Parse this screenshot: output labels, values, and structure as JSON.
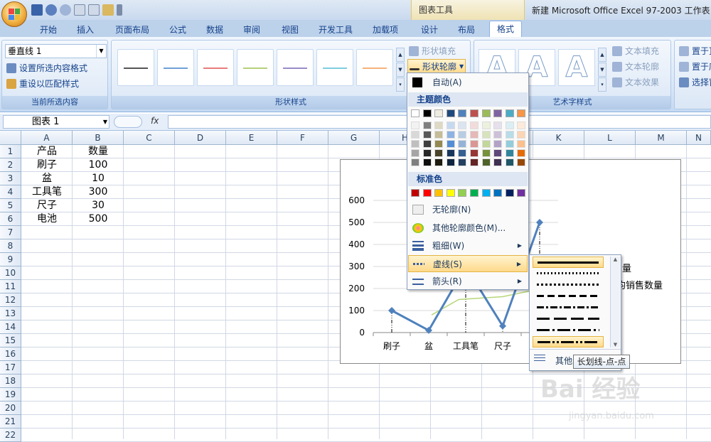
{
  "app": {
    "window_title": "新建 Microsoft Office Excel 97-2003 工作表",
    "context_group": "图表工具"
  },
  "tabs": [
    "开始",
    "插入",
    "页面布局",
    "公式",
    "数据",
    "审阅",
    "视图",
    "开发工具",
    "加载项",
    "设计",
    "布局",
    "格式"
  ],
  "active_tab": "格式",
  "ribbon": {
    "current_selection": {
      "combo_value": "垂直线 1",
      "format_selection": "设置所选内容格式",
      "reset_style": "重设以匹配样式",
      "group_label": "当前所选内容"
    },
    "shape_styles": {
      "group_label": "形状样式",
      "fill": "形状填充",
      "outline": "形状轮廓",
      "line_colors": [
        "#555555",
        "#6f9fd8",
        "#e87c7c",
        "#b6d07a",
        "#9a8cc8",
        "#7ecde0",
        "#f6b27a"
      ]
    },
    "wordart": {
      "group_label": "艺术字样式",
      "letter": "A",
      "text_fill": "文本填充",
      "text_outline": "文本轮廓",
      "text_effects": "文本效果"
    },
    "arrange": {
      "bring_forward": "置于顶",
      "send_backward": "置于底",
      "selection_pane": "选择窗"
    }
  },
  "formula_bar": {
    "name_box": "图表 1",
    "fx": "fx"
  },
  "columns": [
    "A",
    "B",
    "C",
    "D",
    "E",
    "F",
    "G",
    "H",
    "I",
    "J",
    "K",
    "L",
    "M",
    "N"
  ],
  "rows": [
    "1",
    "2",
    "3",
    "4",
    "5",
    "6",
    "7",
    "8",
    "9",
    "10",
    "11",
    "12",
    "13",
    "14",
    "15",
    "16",
    "17",
    "18",
    "19",
    "20",
    "21",
    "22"
  ],
  "table": {
    "header": [
      "产品",
      "数量"
    ],
    "rows": [
      [
        "刷子",
        "100"
      ],
      [
        "盆",
        "10"
      ],
      [
        "工具笔",
        "300"
      ],
      [
        "尺子",
        "30"
      ],
      [
        "电池",
        "500"
      ]
    ]
  },
  "chart_data": {
    "type": "line",
    "categories": [
      "刷子",
      "盆",
      "工具笔",
      "尺子",
      "电池"
    ],
    "series": [
      {
        "name": "",
        "values": [
          100,
          10,
          300,
          30,
          500
        ]
      }
    ],
    "y_ticks": [
      "600",
      "500",
      "400",
      "300",
      "200",
      "100",
      "0"
    ],
    "ylim": [
      0,
      600
    ],
    "legend_fragments": [
      "量",
      "均销售数量"
    ],
    "colors": {
      "series": "#4f81bd",
      "trend": "#b6d77a"
    }
  },
  "outline_menu": {
    "auto": "自动(A)",
    "theme_colors": "主题颜色",
    "theme_row": [
      "#ffffff",
      "#000000",
      "#eeece1",
      "#1f497d",
      "#4f81bd",
      "#c0504d",
      "#9bbb59",
      "#8064a2",
      "#4bacc6",
      "#f79646"
    ],
    "shade_columns": [
      [
        "#f2f2f2",
        "#d8d8d8",
        "#bfbfbf",
        "#a5a5a5",
        "#7f7f7f"
      ],
      [
        "#7f7f7f",
        "#595959",
        "#3f3f3f",
        "#262626",
        "#0c0c0c"
      ],
      [
        "#ddd9c3",
        "#c4bd97",
        "#938953",
        "#494429",
        "#1d1b10"
      ],
      [
        "#c6d9f0",
        "#8db3e2",
        "#548dd4",
        "#17365d",
        "#0f243e"
      ],
      [
        "#dbe5f1",
        "#b8cce4",
        "#95b3d7",
        "#366092",
        "#244061"
      ],
      [
        "#f2dcdb",
        "#e5b9b7",
        "#d99694",
        "#953734",
        "#632423"
      ],
      [
        "#ebf1dd",
        "#d7e3bc",
        "#c3d69b",
        "#76923c",
        "#4f6128"
      ],
      [
        "#e5e0ec",
        "#ccc1d9",
        "#b2a2c7",
        "#5f497a",
        "#3f3151"
      ],
      [
        "#dbeef3",
        "#b7dde8",
        "#92cddc",
        "#31859b",
        "#205867"
      ],
      [
        "#fdeada",
        "#fbd5b5",
        "#fac08f",
        "#e36c09",
        "#974806"
      ]
    ],
    "standard_colors": "标准色",
    "standard_row": [
      "#c00000",
      "#ff0000",
      "#ffc000",
      "#ffff00",
      "#92d050",
      "#00b050",
      "#00b0f0",
      "#0070c0",
      "#002060",
      "#7030a0"
    ],
    "no_outline": "无轮廓(N)",
    "more_colors": "其他轮廓颜色(M)...",
    "weight": "粗细(W)",
    "dashes": "虚线(S)",
    "arrows": "箭头(R)"
  },
  "dash_submenu": {
    "more": "其他线",
    "tooltip": "长划线-点-点"
  },
  "watermark": {
    "brand": "Bai 经验",
    "url": "jingyan.baidu.com"
  }
}
